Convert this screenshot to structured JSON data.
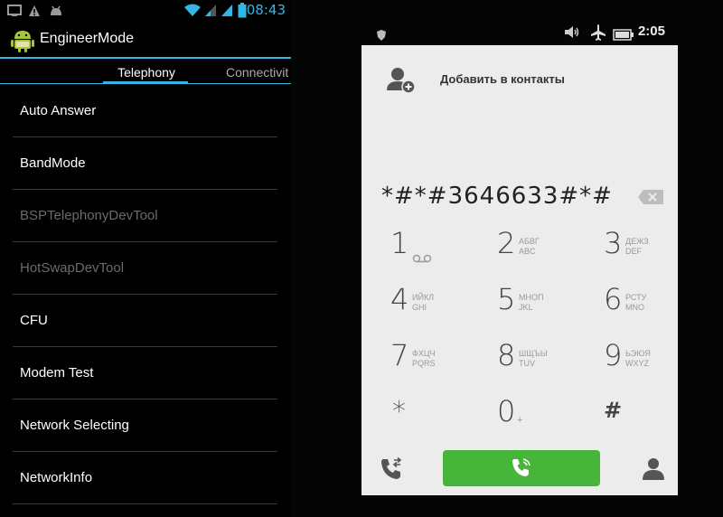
{
  "left": {
    "status_bar": {
      "time": "08:43",
      "icons": [
        "screenshot-icon",
        "warning-icon",
        "android-debug-icon",
        "wifi-icon",
        "signal-icon",
        "signal-icon",
        "battery-icon"
      ]
    },
    "app": {
      "title": "EngineerMode",
      "icon": "android-icon"
    },
    "tabs": [
      {
        "label": "Telephony",
        "active": true
      },
      {
        "label": "Connectivit",
        "active": false
      }
    ],
    "menu": [
      {
        "label": "Auto Answer",
        "enabled": true
      },
      {
        "label": "BandMode",
        "enabled": true
      },
      {
        "label": "BSPTelephonyDevTool",
        "enabled": false
      },
      {
        "label": "HotSwapDevTool",
        "enabled": false
      },
      {
        "label": "CFU",
        "enabled": true
      },
      {
        "label": "Modem Test",
        "enabled": true
      },
      {
        "label": "Network Selecting",
        "enabled": true
      },
      {
        "label": "NetworkInfo",
        "enabled": true
      }
    ],
    "colors": {
      "accent": "#33b5e5",
      "text": "#ffffff",
      "disabled": "#6b6b6b"
    }
  },
  "right": {
    "status_bar": {
      "time": "2:05",
      "icons": [
        "shield-icon",
        "volume-mute-icon",
        "airplane-icon",
        "battery-icon"
      ]
    },
    "add_contact_label": "Добавить в контакты",
    "dialed_number": "*#*#3646633#*#",
    "keys": [
      {
        "digit": "1",
        "letters_top": "",
        "letters_bottom": "voicemail"
      },
      {
        "digit": "2",
        "letters_top": "АБВГ",
        "letters_bottom": "ABC"
      },
      {
        "digit": "3",
        "letters_top": "ДЕЖЗ",
        "letters_bottom": "DEF"
      },
      {
        "digit": "4",
        "letters_top": "ИЙКЛ",
        "letters_bottom": "GHI"
      },
      {
        "digit": "5",
        "letters_top": "МНОП",
        "letters_bottom": "JKL"
      },
      {
        "digit": "6",
        "letters_top": "РСТУ",
        "letters_bottom": "MNO"
      },
      {
        "digit": "7",
        "letters_top": "ФХЦЧ",
        "letters_bottom": "PQRS"
      },
      {
        "digit": "8",
        "letters_top": "ШЩЪЫ",
        "letters_bottom": "TUV"
      },
      {
        "digit": "9",
        "letters_top": "ЬЭЮЯ",
        "letters_bottom": "WXYZ"
      },
      {
        "digit": "*",
        "letters_top": "",
        "letters_bottom": ""
      },
      {
        "digit": "0",
        "letters_top": "",
        "letters_bottom": "+"
      },
      {
        "digit": "#",
        "letters_top": "",
        "letters_bottom": ""
      }
    ],
    "colors": {
      "screen_bg": "#ececec",
      "call_button": "#46b53a"
    }
  }
}
